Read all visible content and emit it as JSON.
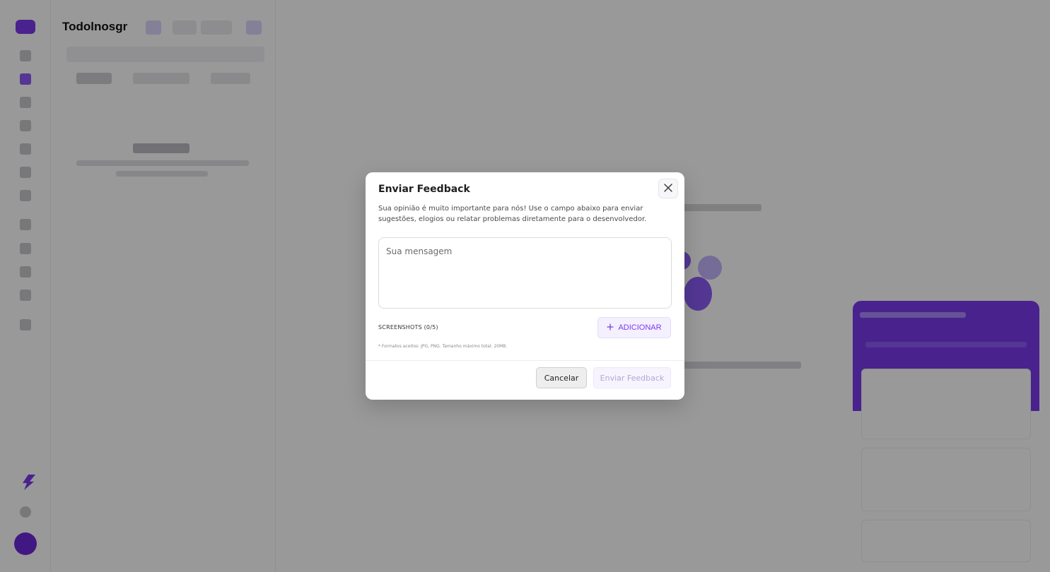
{
  "background_app": {
    "panel_title": "Todolnosgr"
  },
  "modal": {
    "title": "Enviar Feedback",
    "description": "Sua opinião é muito importante para nós! Use o campo abaixo para enviar sugestões, elogios ou relatar problemas diretamente para o desenvolvedor.",
    "message_placeholder": "Sua mensagem",
    "message_value": "",
    "screenshots_label": "SCREENSHOTS (0/5)",
    "add_button_label": "ADICIONAR",
    "formats_note": "* Formatos aceitos: JPG, PNG. Tamanho máximo total: 20MB.",
    "cancel_label": "Cancelar",
    "submit_label": "Enviar Feedback"
  },
  "icons": {
    "close": "close-icon",
    "add": "plus-icon"
  },
  "colors": {
    "accent": "#7c3aed",
    "overlay": "rgba(0,0,0,0.40)",
    "submit_disabled_text": "#b3a6d6"
  }
}
